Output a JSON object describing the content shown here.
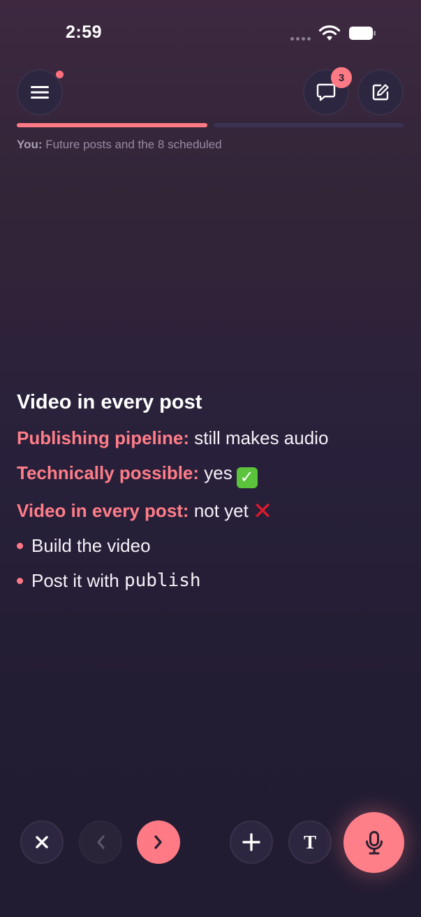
{
  "status_bar": {
    "time": "2:59"
  },
  "header": {
    "menu_icon": "hamburger-icon",
    "chat_icon": "chat-bubble-icon",
    "chat_badge": "3",
    "edit_icon": "compose-icon"
  },
  "progress": {
    "completed_fraction": 0.5,
    "caption_speaker": "You:",
    "caption_text": " Future posts and the 8 scheduled"
  },
  "content": {
    "heading": "Video in every post",
    "rows": [
      {
        "key": "Publishing pipeline:",
        "value": " still makes audio"
      },
      {
        "key": "Technically possible:",
        "value": " yes",
        "mark": "✓"
      },
      {
        "key": "Video in every post:",
        "value": " not yet",
        "mark": "✕"
      }
    ],
    "bullets": [
      {
        "text": "Build the video"
      },
      {
        "text": "Post it with ",
        "code": "publish"
      }
    ]
  },
  "toolbar": {
    "close_icon": "close-icon",
    "prev_icon": "chevron-left-icon",
    "next_icon": "chevron-right-icon",
    "add_icon": "plus-icon",
    "text_label": "T",
    "mic_icon": "microphone-icon"
  },
  "colors": {
    "accent": "#ff7a84",
    "background_top": "#3d2840",
    "background_bottom": "#221c32",
    "success": "#5bc33c",
    "error": "#e01a2b"
  }
}
